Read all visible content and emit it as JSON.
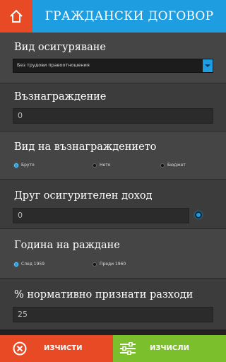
{
  "header": {
    "title": "ГРАЖДАНСКИ ДОГОВОР",
    "home_icon": "home-icon"
  },
  "insurance_type": {
    "label": "Вид осигуряване",
    "selected": "Без трудови правоотношения"
  },
  "remuneration": {
    "label": "Възнаграждение",
    "value": "0"
  },
  "remuneration_type": {
    "label": "Вид на възнаграждението",
    "options": [
      "Бруто",
      "Нето",
      "Бюджет"
    ],
    "selected": "Бруто"
  },
  "other_income": {
    "label": "Друг осигурителен доход",
    "value": "0"
  },
  "birth_year": {
    "label": "Година на раждане",
    "options": [
      "След 1959",
      "Преди 1960"
    ],
    "selected": "След 1959"
  },
  "expenses": {
    "label": "% нормативно признати разходи",
    "value": "25"
  },
  "footer": {
    "clear_label": "ИЗЧИСТИ",
    "calc_label": "ИЗЧИСЛИ"
  },
  "colors": {
    "accent_blue": "#1e9de0",
    "clear_red": "#e84a26",
    "calc_green": "#7cbf2d"
  }
}
